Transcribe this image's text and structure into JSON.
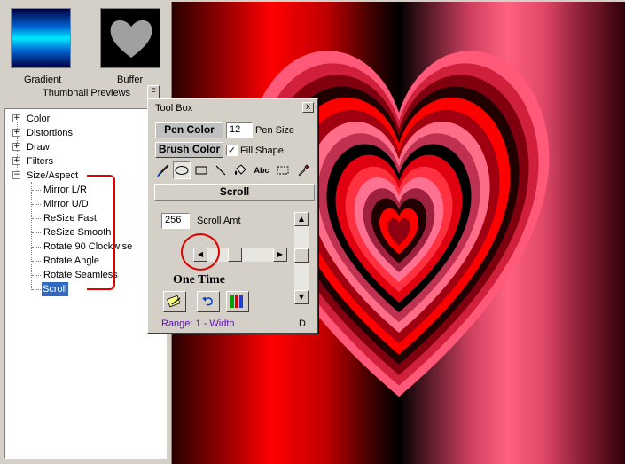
{
  "thumbnails": {
    "gradient_label": "Gradient",
    "buffer_label": "Buffer",
    "section_label": "Thumbnail Previews",
    "toggle_label": "F"
  },
  "tree": {
    "items": [
      {
        "label": "Color",
        "expander": "+"
      },
      {
        "label": "Distortions",
        "expander": "+"
      },
      {
        "label": "Draw",
        "expander": "+"
      },
      {
        "label": "Filters",
        "expander": "+"
      },
      {
        "label": "Size/Aspect",
        "expander": "−"
      }
    ],
    "children": [
      {
        "label": "Mirror L/R"
      },
      {
        "label": "Mirror U/D"
      },
      {
        "label": "ReSize Fast"
      },
      {
        "label": "ReSize Smooth"
      },
      {
        "label": "Rotate 90 Clockwise"
      },
      {
        "label": "Rotate Angle"
      },
      {
        "label": "Rotate Seamless"
      },
      {
        "label": "Scroll",
        "selected": true
      }
    ]
  },
  "toolbox": {
    "title": "Tool Box",
    "close_glyph": "x",
    "pen_color_label": "Pen Color",
    "pen_size_value": "12",
    "pen_size_label": "Pen Size",
    "brush_color_label": "Brush Color",
    "fill_shape_label": "Fill Shape",
    "fill_shape_checked": "✓",
    "abc_tool_label": "Abc",
    "section_title": "Scroll",
    "scroll_amt_value": "256",
    "scroll_amt_label": "Scroll Amt",
    "one_time_label": "One Time",
    "range_text": "Range: 1 - Width",
    "corner_label": "D",
    "horizontal_scroll_position": 0.4,
    "vertical_scroll_position": 0.45
  },
  "colors": {
    "selection": "#316ac5",
    "annotation_red": "#e00000",
    "range_text": "#6010b0"
  }
}
